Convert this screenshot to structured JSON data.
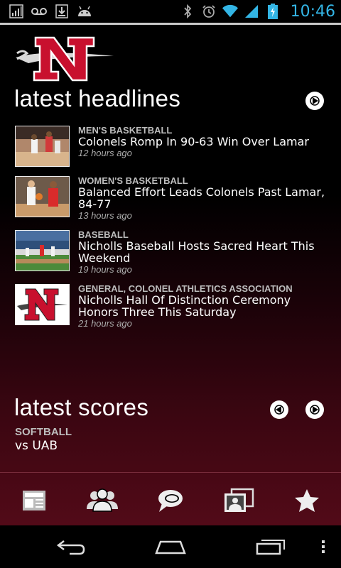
{
  "status_bar": {
    "time": "10:46",
    "left_icons": [
      "signal-bars-icon",
      "voicemail-icon",
      "download-icon",
      "android-icon"
    ],
    "right_icons": [
      "bluetooth-icon",
      "alarm-icon",
      "wifi-icon",
      "cell-signal-icon",
      "battery-charging-icon"
    ],
    "accent_color": "#33b5e5"
  },
  "logo": {
    "letter": "N",
    "brand_color": "#d0112b"
  },
  "headlines": {
    "title": "latest headlines",
    "items": [
      {
        "category": "MEN'S BASKETBALL",
        "title": "Colonels Romp In 90-63 Win Over Lamar",
        "time": "12 hours ago",
        "thumb": "basketball-photo"
      },
      {
        "category": "WOMEN'S BASKETBALL",
        "title": "Balanced Effort Leads Colonels Past Lamar, 84-77",
        "time": "13 hours ago",
        "thumb": "basketball-photo"
      },
      {
        "category": "BASEBALL",
        "title": "Nicholls Baseball Hosts Sacred Heart This Weekend",
        "time": "19 hours ago",
        "thumb": "baseball-photo"
      },
      {
        "category": "GENERAL, COLONEL ATHLETICS ASSOCIATION",
        "title": "Nicholls Hall Of Distinction Ceremony Honors Three This Saturday",
        "time": "21 hours ago",
        "thumb": "nicholls-logo"
      }
    ]
  },
  "scores": {
    "title": "latest scores",
    "sport": "SOFTBALL",
    "opponent": "vs UAB"
  },
  "tabs": [
    "news-icon",
    "roster-icon",
    "social-icon",
    "media-icon",
    "favorites-icon"
  ],
  "nav": [
    "back-icon",
    "home-icon",
    "recent-apps-icon",
    "overflow-menu-icon"
  ]
}
